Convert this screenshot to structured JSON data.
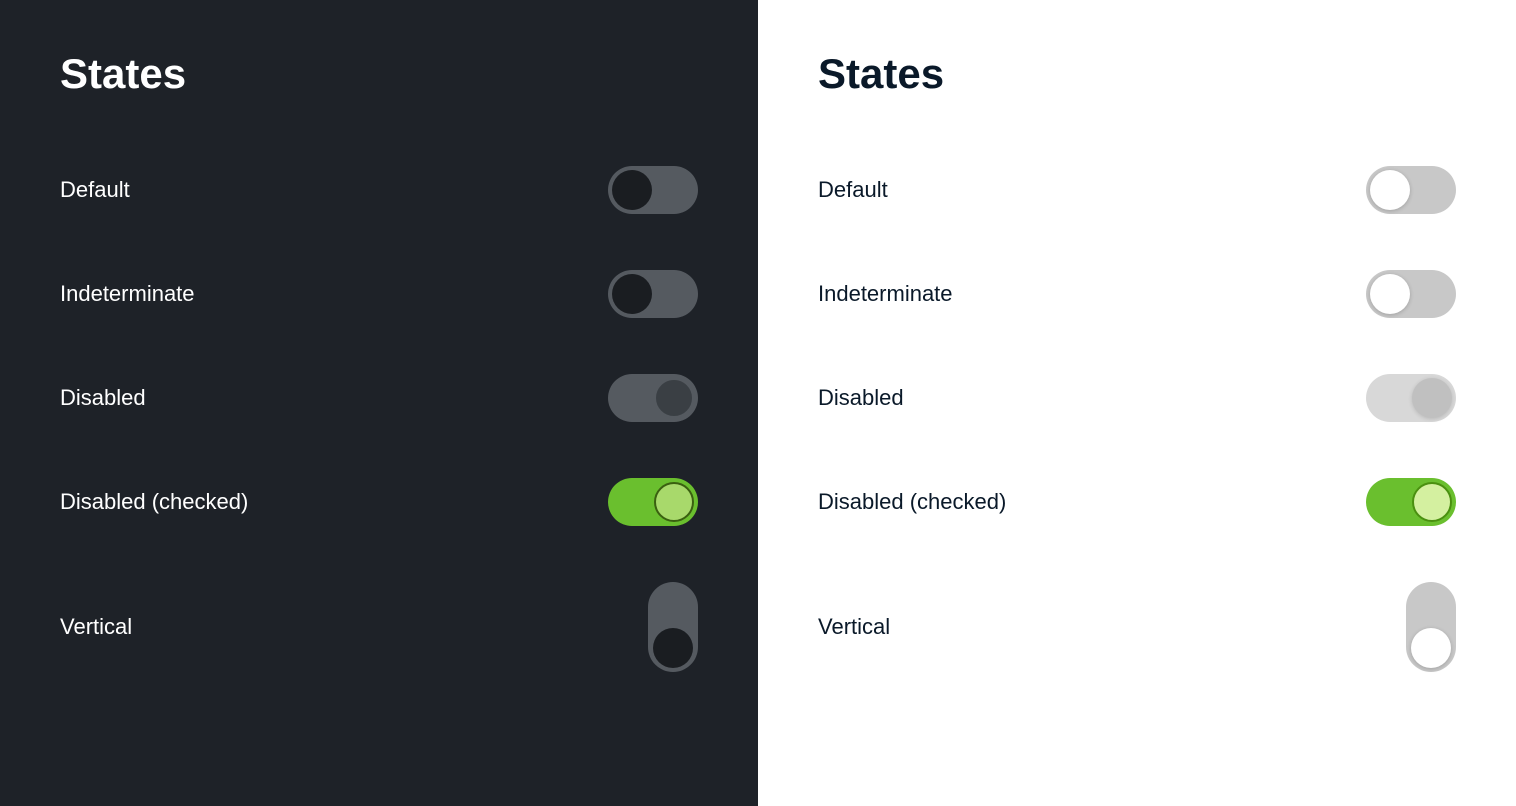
{
  "dark_panel": {
    "title": "States",
    "rows": [
      {
        "id": "default",
        "label": "Default"
      },
      {
        "id": "indeterminate",
        "label": "Indeterminate"
      },
      {
        "id": "disabled",
        "label": "Disabled"
      },
      {
        "id": "disabled-checked",
        "label": "Disabled (checked)"
      },
      {
        "id": "vertical",
        "label": "Vertical"
      }
    ]
  },
  "light_panel": {
    "title": "States",
    "rows": [
      {
        "id": "default",
        "label": "Default"
      },
      {
        "id": "indeterminate",
        "label": "Indeterminate"
      },
      {
        "id": "disabled",
        "label": "Disabled"
      },
      {
        "id": "disabled-checked",
        "label": "Disabled (checked)"
      },
      {
        "id": "vertical",
        "label": "Vertical"
      }
    ]
  }
}
